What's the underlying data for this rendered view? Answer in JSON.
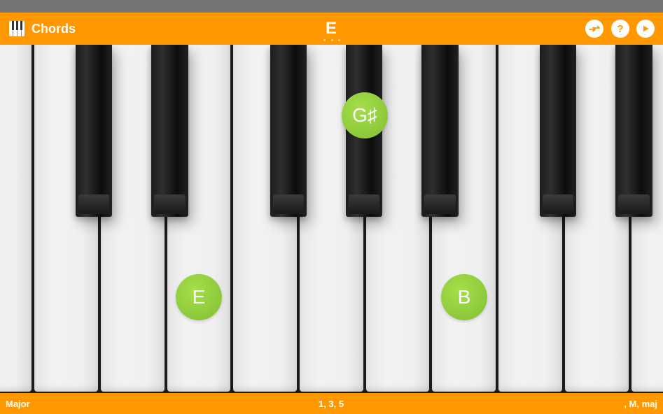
{
  "app": {
    "title": "Chords",
    "icon": "piano-keys-icon",
    "accent_color": "#ff9800"
  },
  "header": {
    "current_chord": "E",
    "actions": [
      {
        "icon": "invert-swap-icon"
      },
      {
        "icon": "help-icon",
        "glyph": "?"
      },
      {
        "icon": "play-icon"
      }
    ]
  },
  "keyboard": {
    "highlighted_notes": [
      {
        "name": "E",
        "key": "white"
      },
      {
        "name": "G♯",
        "key": "black"
      },
      {
        "name": "B",
        "key": "white"
      }
    ],
    "marker_color": "#8cc93a"
  },
  "footer": {
    "quality": "Major",
    "formula": "1, 3, 5",
    "symbols": ", M, maj"
  }
}
